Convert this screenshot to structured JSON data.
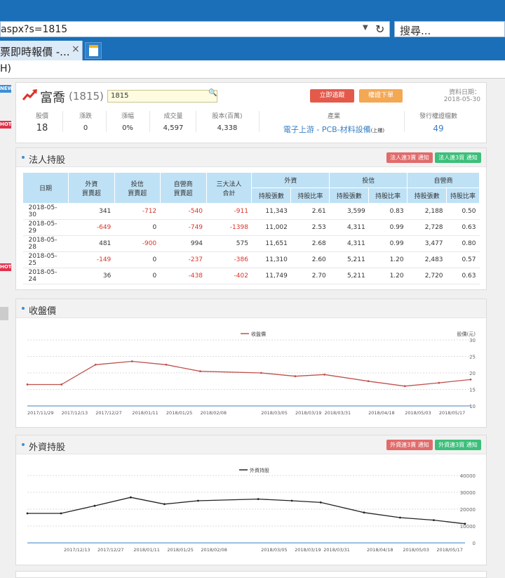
{
  "browser": {
    "url": "aspx?s=1815",
    "search_placeholder": "搜尋...",
    "tab_title": "票即時報價 -...",
    "tab_close": "×",
    "menu_fragment": "H)",
    "left_badges": [
      "NEW",
      "HOT",
      "HOT"
    ]
  },
  "stock": {
    "name": "富喬",
    "code": "(1815)",
    "search_value": "1815",
    "track_button": "立即追蹤",
    "warrant_button": "權證下單",
    "date_label": "資料日期：",
    "date_value": "2018-05-30",
    "info": [
      {
        "label": "股價",
        "value": "18"
      },
      {
        "label": "漲跌",
        "value": "0"
      },
      {
        "label": "漲幅",
        "value": "0%"
      },
      {
        "label": "成交量",
        "value": "4,597"
      },
      {
        "label": "股本(百萬)",
        "value": "4,338"
      }
    ],
    "industry_label": "產業",
    "industry_value": "電子上游 - PCB-材料設備",
    "industry_suffix": "(上櫃)",
    "warrants_label": "發行權證檔數",
    "warrants_value": "49"
  },
  "institutional": {
    "title": "法人持股",
    "btn_sell": "法人連3賣 通知",
    "btn_buy": "法人連3買 通知",
    "headers": {
      "date": "日期",
      "foreign": "外資",
      "trust": "投信",
      "dealer": "自營商",
      "three": "三大法人",
      "buy_sell": "買賣超",
      "total": "合計",
      "holdings": "持股張數",
      "ratio": "持股比率"
    },
    "rows": [
      {
        "date": "2018-05-30",
        "foreign": "341",
        "trust": "-712",
        "dealer": "-540",
        "total": "-911",
        "f_hold": "11,343",
        "f_ratio": "2.61",
        "t_hold": "3,599",
        "t_ratio": "0.83",
        "d_hold": "2,188",
        "d_ratio": "0.50"
      },
      {
        "date": "2018-05-29",
        "foreign": "-649",
        "trust": "0",
        "dealer": "-749",
        "total": "-1398",
        "f_hold": "11,002",
        "f_ratio": "2.53",
        "t_hold": "4,311",
        "t_ratio": "0.99",
        "d_hold": "2,728",
        "d_ratio": "0.63"
      },
      {
        "date": "2018-05-28",
        "foreign": "481",
        "trust": "-900",
        "dealer": "994",
        "total": "575",
        "f_hold": "11,651",
        "f_ratio": "2.68",
        "t_hold": "4,311",
        "t_ratio": "0.99",
        "d_hold": "3,477",
        "d_ratio": "0.80"
      },
      {
        "date": "2018-05-25",
        "foreign": "-149",
        "trust": "0",
        "dealer": "-237",
        "total": "-386",
        "f_hold": "11,310",
        "f_ratio": "2.60",
        "t_hold": "5,211",
        "t_ratio": "1.20",
        "d_hold": "2,483",
        "d_ratio": "0.57"
      },
      {
        "date": "2018-05-24",
        "foreign": "36",
        "trust": "0",
        "dealer": "-438",
        "total": "-402",
        "f_hold": "11,749",
        "f_ratio": "2.70",
        "t_hold": "5,211",
        "t_ratio": "1.20",
        "d_hold": "2,720",
        "d_ratio": "0.63"
      }
    ]
  },
  "price_section": {
    "title": "收盤價"
  },
  "foreign_section": {
    "title": "外資持股",
    "btn_sell": "外資連3賣 通知",
    "btn_buy": "外資連3買 通知"
  },
  "colors": {
    "price_line": "#c0504d",
    "holding_line": "#222222",
    "accent": "#1a6fb8"
  },
  "chart_data": [
    {
      "type": "line",
      "title": "",
      "legend": "收盤價",
      "ylabel": "股價(元)",
      "ylim": [
        10,
        30
      ],
      "yticks": [
        "30",
        "25",
        "20",
        "15",
        "10"
      ],
      "xticks": [
        "2017/11/29",
        "2017/12/13",
        "2017/12/27",
        "2018/01/11",
        "2018/01/25",
        "2018/02/08",
        "2018/03/05",
        "2018/03/19",
        "2018/03/31",
        "2018/04/18",
        "2018/05/03",
        "2018/05/17"
      ],
      "grid": true,
      "x": [
        "2017/11/29",
        "2017/12/13",
        "2017/12/27",
        "2018/01/11",
        "2018/01/25",
        "2018/02/08",
        "2018/03/05",
        "2018/03/19",
        "2018/03/31",
        "2018/04/18",
        "2018/05/03",
        "2018/05/17",
        "2018/05/30"
      ],
      "values": [
        16.5,
        16.5,
        22.5,
        23.5,
        22.5,
        20.5,
        20,
        19,
        19.5,
        17.5,
        16,
        17,
        18
      ]
    },
    {
      "type": "line",
      "title": "",
      "legend": "外資持股",
      "ylim": [
        0,
        40000
      ],
      "yticks": [
        "40000",
        "30000",
        "20000",
        "10000",
        "0"
      ],
      "xticks": [
        "2017/12/13",
        "2017/12/27",
        "2018/01/11",
        "2018/01/25",
        "2018/02/08",
        "2018/03/05",
        "2018/03/19",
        "2018/03/31",
        "2018/04/18",
        "2018/05/03",
        "2018/05/17"
      ],
      "grid": true,
      "x": [
        "2017/11/29",
        "2017/12/13",
        "2017/12/27",
        "2018/01/11",
        "2018/01/25",
        "2018/02/08",
        "2018/03/05",
        "2018/03/19",
        "2018/03/31",
        "2018/04/18",
        "2018/05/03",
        "2018/05/17",
        "2018/05/30"
      ],
      "values": [
        17500,
        17500,
        22000,
        27000,
        23000,
        25000,
        26000,
        25000,
        24000,
        18000,
        15000,
        13500,
        11343
      ]
    }
  ]
}
